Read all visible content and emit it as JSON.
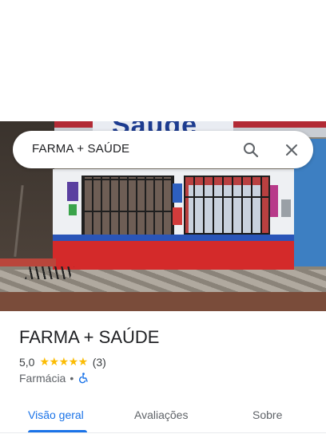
{
  "search": {
    "query": "FARMA + SAÚDE"
  },
  "photo": {
    "sign_text": "Saúde"
  },
  "place": {
    "name": "FARMA + SAÚDE",
    "rating": "5,0",
    "stars": "★★★★★",
    "rating_fraction": 1.0,
    "review_count": "(3)",
    "category": "Farmácia",
    "separator": "•",
    "accessibility_icon": "wheelchair-icon"
  },
  "tabs": [
    {
      "label": "Visão geral",
      "active": true
    },
    {
      "label": "Avaliações",
      "active": false
    },
    {
      "label": "Sobre",
      "active": false
    }
  ],
  "colors": {
    "accent": "#1a73e8",
    "star": "#fbbc04",
    "storefront_red": "#d42a2a",
    "storefront_blue": "#2a55b8"
  },
  "icons": {
    "search": "search-icon",
    "close": "close-icon"
  }
}
